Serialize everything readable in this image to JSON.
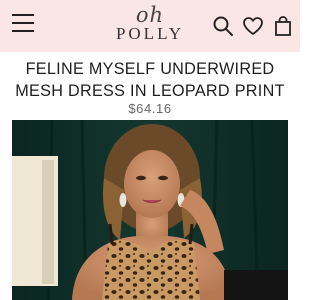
{
  "header": {
    "logo_script": "oh",
    "logo_brand": "POLLY",
    "icons": [
      "menu-icon",
      "search-icon",
      "heart-icon",
      "shopping-bag-icon"
    ]
  },
  "product": {
    "title_line1": "FELINE MYSELF UNDERWIRED",
    "title_line2": "MESH DRESS IN LEOPARD PRINT",
    "price": "$64.16"
  },
  "colors": {
    "header_bg": "#fbe6e6",
    "photo_bg": "#0e2a23"
  }
}
